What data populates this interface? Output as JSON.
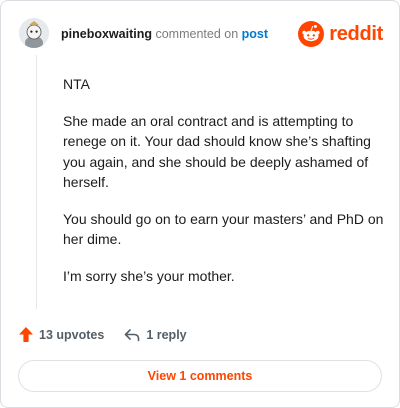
{
  "header": {
    "username": "pineboxwaiting",
    "action_text": "commented on",
    "post_link_label": "post",
    "brand_label": "reddit"
  },
  "comment": {
    "paragraphs": [
      "NTA",
      "She made an oral contract and is attempting to renege on it. Your dad should know she’s shafting you again, and she should be deeply ashamed of herself.",
      "You should go on to earn your masters’ and PhD on her dime.",
      "I’m sorry she’s your mother."
    ]
  },
  "footer": {
    "upvotes_label": "13 upvotes",
    "reply_label": "1 reply",
    "view_comments_label": "View 1 comments"
  },
  "icons": {
    "upvote": "arrow-up-icon",
    "reply": "reply-arrow-icon",
    "brand": "reddit-snoo-icon"
  },
  "colors": {
    "brand": "#ff4500",
    "link": "#0079d3",
    "muted": "#7c7c7c"
  }
}
